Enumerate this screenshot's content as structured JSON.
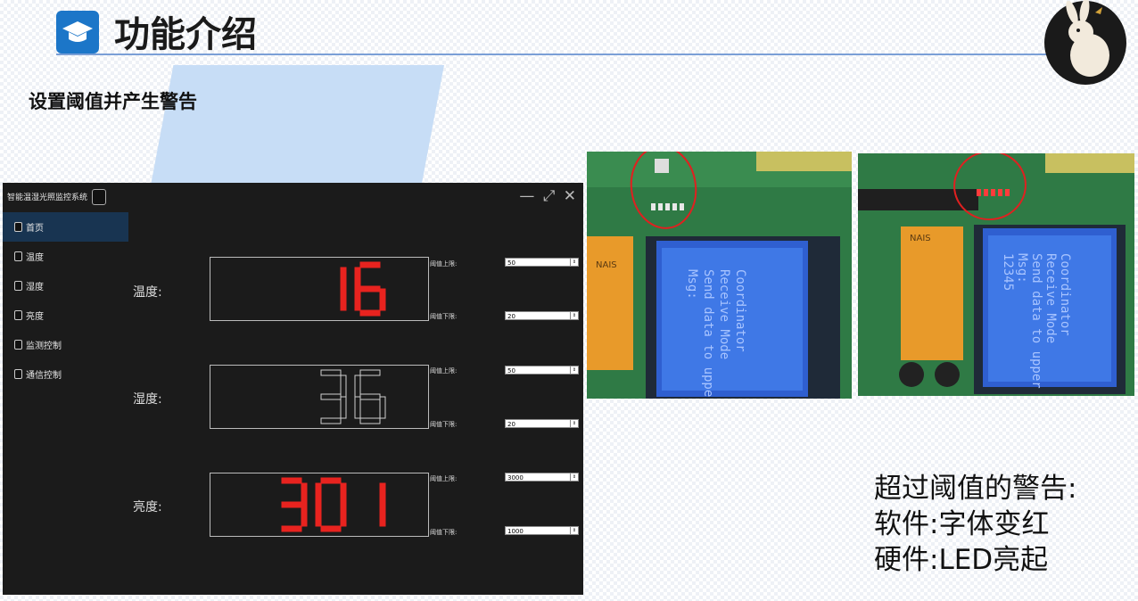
{
  "slide": {
    "title": "功能介绍",
    "subtitle": "设置阈值并产生警告",
    "caption": {
      "line1": "超过阈值的警告:",
      "line2": "软件:字体变红",
      "line3": "硬件:LED亮起"
    }
  },
  "app": {
    "window_title": "智能温湿光照监控系统",
    "window_controls": "— ⤢ ✕",
    "sidebar": {
      "items": [
        {
          "label": "首页",
          "active": true
        },
        {
          "label": "温度"
        },
        {
          "label": "湿度"
        },
        {
          "label": "亮度"
        },
        {
          "label": "监测控制"
        },
        {
          "label": "通信控制"
        }
      ]
    },
    "rows": [
      {
        "label": "温度:",
        "value": "16",
        "color": "#e8231f",
        "upper_label": "阈值上限:",
        "upper": "50",
        "lower_label": "阈值下限:",
        "lower": "20"
      },
      {
        "label": "湿度:",
        "value": "36",
        "color": "#1b1b1b",
        "upper_label": "阈值上限:",
        "upper": "50",
        "lower_label": "阈值下限:",
        "lower": "20"
      },
      {
        "label": "亮度:",
        "value": "301",
        "color": "#e8231f",
        "upper_label": "阈值上限:",
        "upper": "3000",
        "lower_label": "阈值下限:",
        "lower": "1000"
      }
    ]
  },
  "hardware_photos": {
    "left": {
      "lcd_lines": [
        "Coordinator",
        "Receive Mode",
        "Send data to upper",
        "Msg:"
      ],
      "board_label": "NAIS",
      "led_on": false
    },
    "right": {
      "lcd_lines": [
        "Coordinator",
        "Receive Mode",
        "Send data to upper",
        "Msg:",
        "12345"
      ],
      "board_label": "NAIS",
      "led_on": true
    }
  },
  "colors": {
    "accent": "#1c76c8",
    "warning_red": "#e8231f",
    "app_bg": "#1b1b1b",
    "sidebar_active": "#183451"
  }
}
